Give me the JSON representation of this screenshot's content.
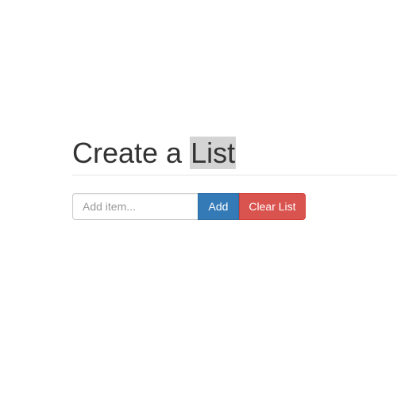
{
  "header": {
    "title_prefix": "Create a ",
    "title_highlight": "List"
  },
  "form": {
    "input_value": "",
    "input_placeholder": "Add item...",
    "add_label": "Add",
    "clear_label": "Clear List"
  },
  "colors": {
    "add_button": "#337ab7",
    "clear_button": "#d9534f",
    "title_highlight": "#d4d4d4"
  }
}
